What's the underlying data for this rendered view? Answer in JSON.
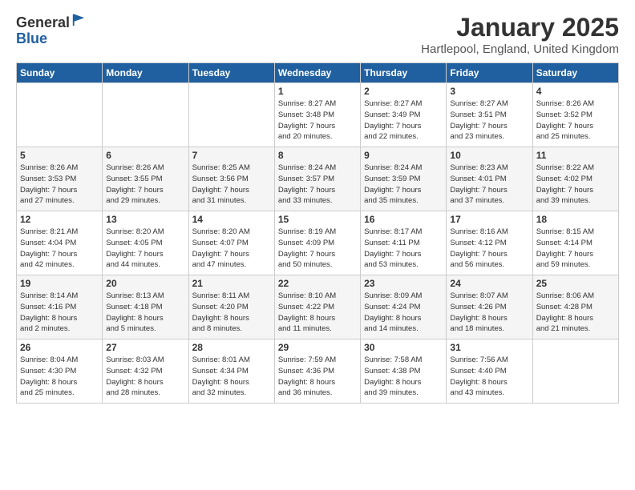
{
  "logo": {
    "general": "General",
    "blue": "Blue"
  },
  "title": "January 2025",
  "location": "Hartlepool, England, United Kingdom",
  "headers": [
    "Sunday",
    "Monday",
    "Tuesday",
    "Wednesday",
    "Thursday",
    "Friday",
    "Saturday"
  ],
  "weeks": [
    [
      {
        "day": "",
        "detail": ""
      },
      {
        "day": "",
        "detail": ""
      },
      {
        "day": "",
        "detail": ""
      },
      {
        "day": "1",
        "detail": "Sunrise: 8:27 AM\nSunset: 3:48 PM\nDaylight: 7 hours\nand 20 minutes."
      },
      {
        "day": "2",
        "detail": "Sunrise: 8:27 AM\nSunset: 3:49 PM\nDaylight: 7 hours\nand 22 minutes."
      },
      {
        "day": "3",
        "detail": "Sunrise: 8:27 AM\nSunset: 3:51 PM\nDaylight: 7 hours\nand 23 minutes."
      },
      {
        "day": "4",
        "detail": "Sunrise: 8:26 AM\nSunset: 3:52 PM\nDaylight: 7 hours\nand 25 minutes."
      }
    ],
    [
      {
        "day": "5",
        "detail": "Sunrise: 8:26 AM\nSunset: 3:53 PM\nDaylight: 7 hours\nand 27 minutes."
      },
      {
        "day": "6",
        "detail": "Sunrise: 8:26 AM\nSunset: 3:55 PM\nDaylight: 7 hours\nand 29 minutes."
      },
      {
        "day": "7",
        "detail": "Sunrise: 8:25 AM\nSunset: 3:56 PM\nDaylight: 7 hours\nand 31 minutes."
      },
      {
        "day": "8",
        "detail": "Sunrise: 8:24 AM\nSunset: 3:57 PM\nDaylight: 7 hours\nand 33 minutes."
      },
      {
        "day": "9",
        "detail": "Sunrise: 8:24 AM\nSunset: 3:59 PM\nDaylight: 7 hours\nand 35 minutes."
      },
      {
        "day": "10",
        "detail": "Sunrise: 8:23 AM\nSunset: 4:01 PM\nDaylight: 7 hours\nand 37 minutes."
      },
      {
        "day": "11",
        "detail": "Sunrise: 8:22 AM\nSunset: 4:02 PM\nDaylight: 7 hours\nand 39 minutes."
      }
    ],
    [
      {
        "day": "12",
        "detail": "Sunrise: 8:21 AM\nSunset: 4:04 PM\nDaylight: 7 hours\nand 42 minutes."
      },
      {
        "day": "13",
        "detail": "Sunrise: 8:20 AM\nSunset: 4:05 PM\nDaylight: 7 hours\nand 44 minutes."
      },
      {
        "day": "14",
        "detail": "Sunrise: 8:20 AM\nSunset: 4:07 PM\nDaylight: 7 hours\nand 47 minutes."
      },
      {
        "day": "15",
        "detail": "Sunrise: 8:19 AM\nSunset: 4:09 PM\nDaylight: 7 hours\nand 50 minutes."
      },
      {
        "day": "16",
        "detail": "Sunrise: 8:17 AM\nSunset: 4:11 PM\nDaylight: 7 hours\nand 53 minutes."
      },
      {
        "day": "17",
        "detail": "Sunrise: 8:16 AM\nSunset: 4:12 PM\nDaylight: 7 hours\nand 56 minutes."
      },
      {
        "day": "18",
        "detail": "Sunrise: 8:15 AM\nSunset: 4:14 PM\nDaylight: 7 hours\nand 59 minutes."
      }
    ],
    [
      {
        "day": "19",
        "detail": "Sunrise: 8:14 AM\nSunset: 4:16 PM\nDaylight: 8 hours\nand 2 minutes."
      },
      {
        "day": "20",
        "detail": "Sunrise: 8:13 AM\nSunset: 4:18 PM\nDaylight: 8 hours\nand 5 minutes."
      },
      {
        "day": "21",
        "detail": "Sunrise: 8:11 AM\nSunset: 4:20 PM\nDaylight: 8 hours\nand 8 minutes."
      },
      {
        "day": "22",
        "detail": "Sunrise: 8:10 AM\nSunset: 4:22 PM\nDaylight: 8 hours\nand 11 minutes."
      },
      {
        "day": "23",
        "detail": "Sunrise: 8:09 AM\nSunset: 4:24 PM\nDaylight: 8 hours\nand 14 minutes."
      },
      {
        "day": "24",
        "detail": "Sunrise: 8:07 AM\nSunset: 4:26 PM\nDaylight: 8 hours\nand 18 minutes."
      },
      {
        "day": "25",
        "detail": "Sunrise: 8:06 AM\nSunset: 4:28 PM\nDaylight: 8 hours\nand 21 minutes."
      }
    ],
    [
      {
        "day": "26",
        "detail": "Sunrise: 8:04 AM\nSunset: 4:30 PM\nDaylight: 8 hours\nand 25 minutes."
      },
      {
        "day": "27",
        "detail": "Sunrise: 8:03 AM\nSunset: 4:32 PM\nDaylight: 8 hours\nand 28 minutes."
      },
      {
        "day": "28",
        "detail": "Sunrise: 8:01 AM\nSunset: 4:34 PM\nDaylight: 8 hours\nand 32 minutes."
      },
      {
        "day": "29",
        "detail": "Sunrise: 7:59 AM\nSunset: 4:36 PM\nDaylight: 8 hours\nand 36 minutes."
      },
      {
        "day": "30",
        "detail": "Sunrise: 7:58 AM\nSunset: 4:38 PM\nDaylight: 8 hours\nand 39 minutes."
      },
      {
        "day": "31",
        "detail": "Sunrise: 7:56 AM\nSunset: 4:40 PM\nDaylight: 8 hours\nand 43 minutes."
      },
      {
        "day": "",
        "detail": ""
      }
    ]
  ]
}
